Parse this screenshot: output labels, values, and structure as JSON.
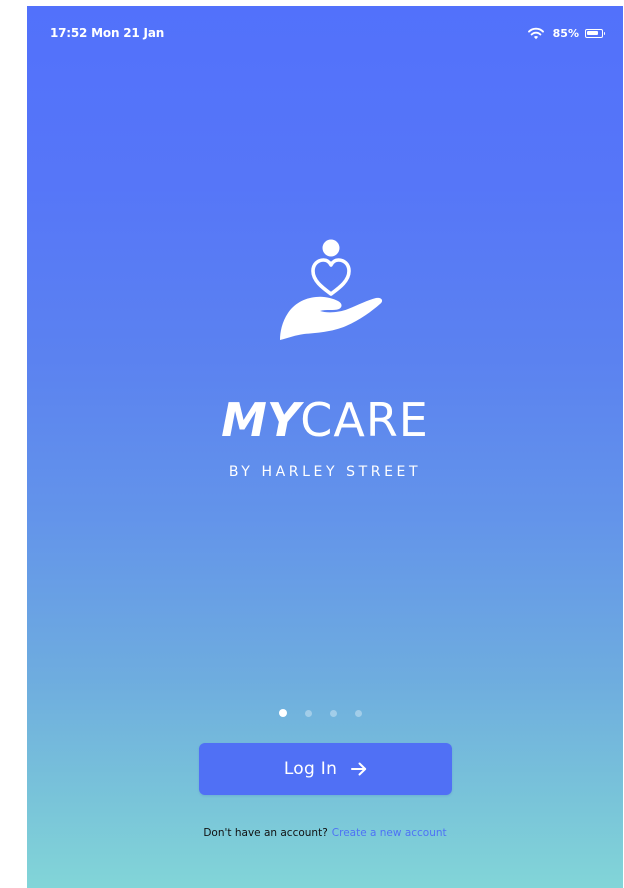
{
  "status_bar": {
    "time": "17:52 Mon 21 Jan",
    "battery_text": "85%",
    "battery_level": 0.85,
    "icons": [
      "wifi-icon",
      "battery-icon"
    ]
  },
  "brand": {
    "logo_icon": "caring-hand-heart-person-icon",
    "title_bold": "MY",
    "title_light": "CARE",
    "subtitle": "BY HARLEY STREET"
  },
  "onboarding": {
    "page_count": 4,
    "active_page": 1
  },
  "login_button": {
    "label": "Log In",
    "icon": "arrow-right-icon"
  },
  "signup": {
    "prompt": "Don't have an account?",
    "link": "Create a new account"
  },
  "colors": {
    "gradient_top": "#5271fb",
    "gradient_bottom": "#82d5d8",
    "button": "#5070f5",
    "link": "#4e72f5"
  }
}
